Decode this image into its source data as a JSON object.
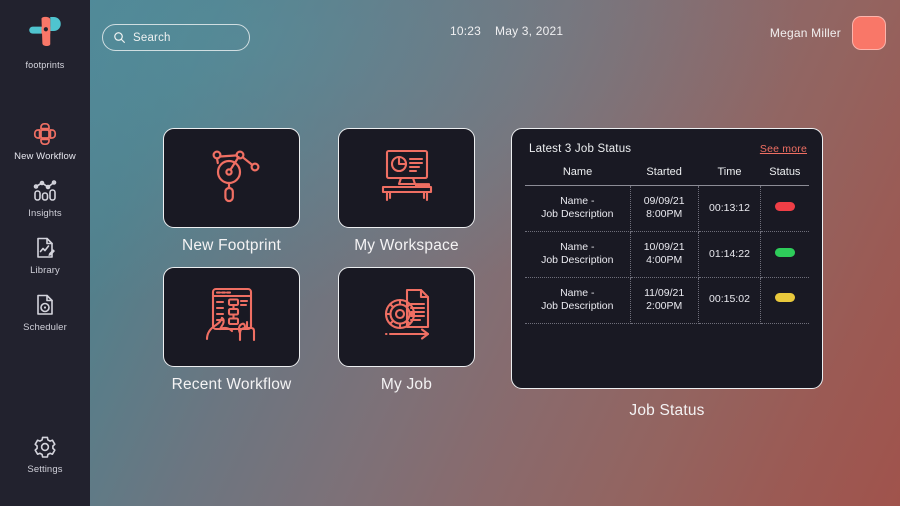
{
  "brand": {
    "name": "footprints",
    "logo_icon": "footprints-logo-icon",
    "accent_color": "#f97768",
    "teal_color": "#4fc4cf"
  },
  "sidebar": {
    "items": [
      {
        "label": "New Workflow",
        "icon": "workflow-nodes-icon",
        "accent": true
      },
      {
        "label": "Insights",
        "icon": "bar-chart-insights-icon",
        "accent": false
      },
      {
        "label": "Library",
        "icon": "document-pencil-icon",
        "accent": false
      },
      {
        "label": "Scheduler",
        "icon": "document-clock-icon",
        "accent": false
      }
    ],
    "settings": {
      "label": "Settings",
      "icon": "gear-icon"
    }
  },
  "header": {
    "search": {
      "placeholder": "Search",
      "value": "",
      "icon": "search-icon"
    },
    "time": "10:23",
    "date": "May 3, 2021",
    "user": {
      "name": "Megan Miller",
      "avatar_color": "#f97768"
    }
  },
  "tiles": [
    {
      "label": "New Footprint",
      "icon": "network-graph-magnifier-icon"
    },
    {
      "label": "My Workspace",
      "icon": "desktop-monitor-chart-icon"
    },
    {
      "label": "Recent Workflow",
      "icon": "tablet-flowchart-hand-icon"
    },
    {
      "label": "My Job",
      "icon": "gear-document-arrow-icon"
    }
  ],
  "job_panel": {
    "title": "Latest 3 Job Status",
    "see_more": "See more",
    "caption": "Job Status",
    "columns": [
      "Name",
      "Started",
      "Time",
      "Status"
    ],
    "rows": [
      {
        "name_line1": "Name -",
        "name_line2": "Job Description",
        "started_line1": "09/09/21",
        "started_line2": "8:00PM",
        "time": "00:13:12",
        "status_color": "#ef3e46",
        "status_label": "failed"
      },
      {
        "name_line1": "Name -",
        "name_line2": "Job Description",
        "started_line1": "10/09/21",
        "started_line2": "4:00PM",
        "time": "01:14:22",
        "status_color": "#2ecc5a",
        "status_label": "success"
      },
      {
        "name_line1": "Name -",
        "name_line2": "Job Description",
        "started_line1": "11/09/21",
        "started_line2": "2:00PM",
        "time": "00:15:02",
        "status_color": "#e8c83c",
        "status_label": "warning"
      }
    ]
  }
}
